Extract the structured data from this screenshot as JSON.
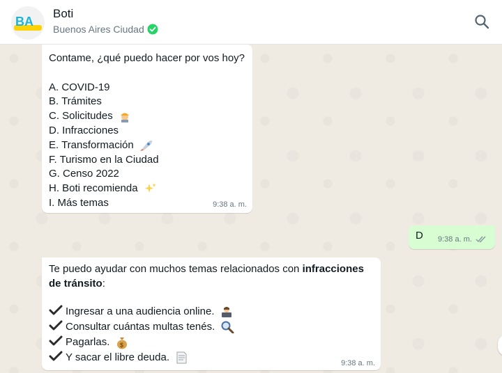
{
  "header": {
    "name": "Boti",
    "subtitle": "Buenos Aires Ciudad",
    "logo_text": "BA"
  },
  "colors": {
    "accent": "#25d366",
    "outgoing_bubble": "#d9fdd3",
    "incoming_bubble": "#ffffff",
    "chat_bg": "#efeae2",
    "verified": "#25d366"
  },
  "messages": {
    "menu": {
      "intro": "Contame, ¿qué puedo hacer por vos hoy?",
      "options": [
        "A. COVID-19",
        "B. Trámites",
        "C. Solicitudes",
        "D. Infracciones",
        "E. Transformación",
        "F. Turismo en la Ciudad",
        "G. Censo 2022",
        "H. Boti recomienda",
        "I. Más temas"
      ],
      "time": "9:38 a. m."
    },
    "reply": {
      "text": "D",
      "time": "9:38 a. m."
    },
    "infracciones": {
      "intro_plain": "Te puedo ayudar con muchos temas relacionados con ",
      "intro_bold_1": "infracciones",
      "intro_bold_2": "de tránsito",
      "intro_colon": ":",
      "items": [
        "Ingresar a una audiencia online.",
        "Consultar cuántas multas tenés.",
        "Pagarlas.",
        "Y sacar el libre deuda."
      ],
      "time": "9:38 a. m."
    }
  },
  "icons": {
    "search": "search-icon",
    "verified": "verified-badge-icon",
    "read_receipt": "double-check-icon"
  }
}
